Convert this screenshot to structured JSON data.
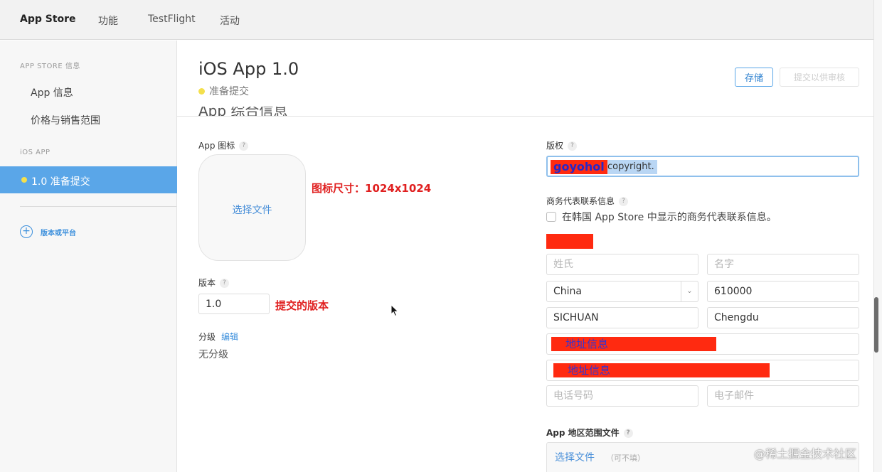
{
  "topnav": {
    "tabs": [
      {
        "label": "App Store",
        "active": true
      },
      {
        "label": "功能",
        "active": false
      },
      {
        "label": "TestFlight",
        "active": false
      },
      {
        "label": "活动",
        "active": false
      }
    ]
  },
  "sidebar": {
    "store_section": "APP STORE 信息",
    "store_items": [
      "App 信息",
      "价格与销售范围"
    ],
    "ios_section": "iOS APP",
    "active_version": "1.0 准备提交",
    "add_label": "版本或平台"
  },
  "header": {
    "title": "iOS App 1.0",
    "status": "准备提交",
    "save_label": "存储",
    "submit_label": "提交以供审核",
    "section_title": "App 综合信息"
  },
  "left": {
    "icon_label": "App 图标",
    "icon_choose": "选择文件",
    "icon_note": "图标尺寸：1024x1024",
    "version_label": "版本",
    "version_value": "1.0",
    "version_note": "提交的版本",
    "grade_label": "分级",
    "grade_edit": "编辑",
    "grade_value": "无分级"
  },
  "right": {
    "copyright_label": "版权",
    "copyright_redacted": "goyohol",
    "copyright_rest": "copyright.",
    "rep_label": "商务代表联系信息",
    "rep_checkbox": "在韩国 App Store 中显示的商务代表联系信息。",
    "last_name_ph": "姓氏",
    "first_name_ph": "名字",
    "country": "China",
    "postal": "610000",
    "province": "SICHUAN",
    "city": "Chengdu",
    "address1": "地址信息",
    "address2": "地址信息",
    "phone_ph": "电话号码",
    "email_ph": "电子邮件",
    "region_label": "App 地区范围文件",
    "region_choose": "选择文件",
    "region_optional": "（可不填）"
  },
  "watermark": "@稀土掘金技术社区",
  "colors": {
    "accent": "#5aa6e8",
    "link": "#3b8fdc",
    "redaction": "#ff2a10",
    "note_red": "#e02020",
    "status_dot": "#f4e04d"
  }
}
